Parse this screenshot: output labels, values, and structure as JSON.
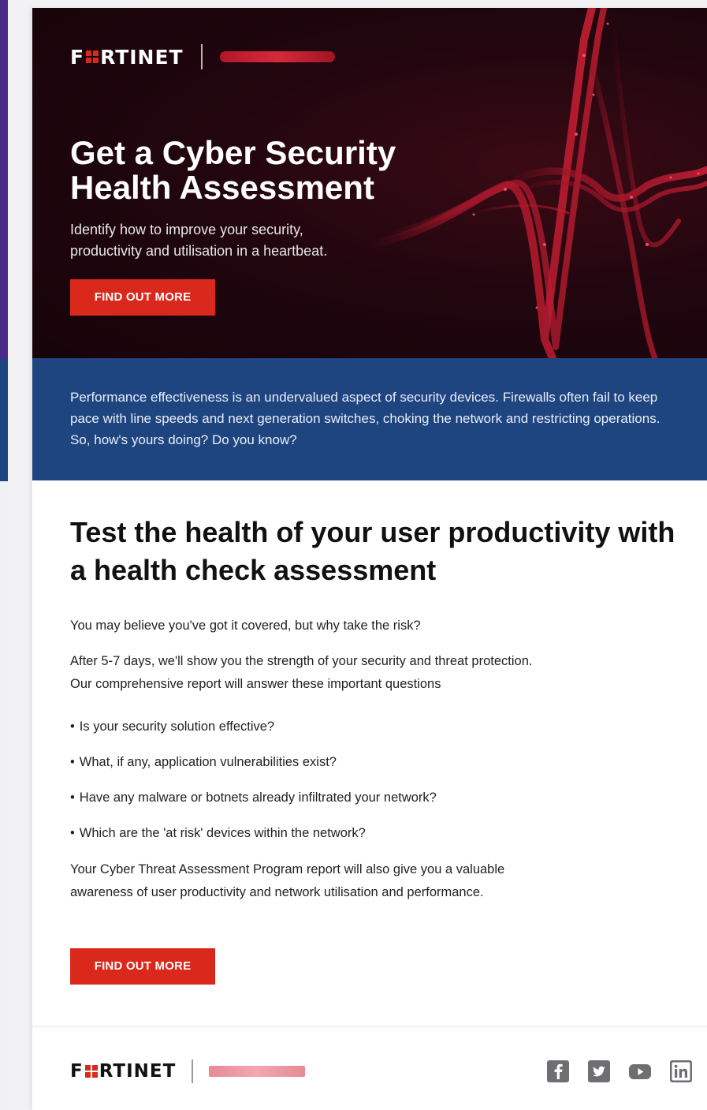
{
  "brand": {
    "logo": "FORTINET",
    "accent": "#da291c",
    "hero_bg": "#22060f",
    "band_bg": "#1f4580"
  },
  "hero": {
    "title_line1": "Get a Cyber Security",
    "title_line2": "Health Assessment",
    "subtitle_line1": "Identify how to improve your security,",
    "subtitle_line2": "productivity and utilisation in a heartbeat.",
    "cta_label": "FIND OUT MORE"
  },
  "band": {
    "text": "Performance effectiveness is an undervalued aspect of security devices. Firewalls often fail to keep pace with line speeds and next generation switches, choking the network and restricting operations. So, how's yours doing? Do you know?"
  },
  "body": {
    "heading": "Test the health of your user productivity with a health check assessment",
    "intro": "You may believe you've got it covered, but why take the risk?",
    "para_line1": "After 5-7 days, we'll show you the strength of your security and threat protection.",
    "para_line2": "Our comprehensive report will answer these important questions",
    "bullets": [
      "Is your security solution effective?",
      "What, if any, application vulnerabilities exist?",
      "Have any malware or botnets already infiltrated your network?",
      "Which are the 'at risk' devices within the network?"
    ],
    "closing_line1": "Your Cyber Threat Assessment Program report will also give you a valuable",
    "closing_line2": "awareness of user productivity and network utilisation and performance.",
    "cta_label": "FIND OUT MORE"
  },
  "footer": {
    "logo": "FORTINET",
    "social": [
      "facebook-icon",
      "twitter-icon",
      "youtube-icon",
      "linkedin-icon"
    ]
  }
}
